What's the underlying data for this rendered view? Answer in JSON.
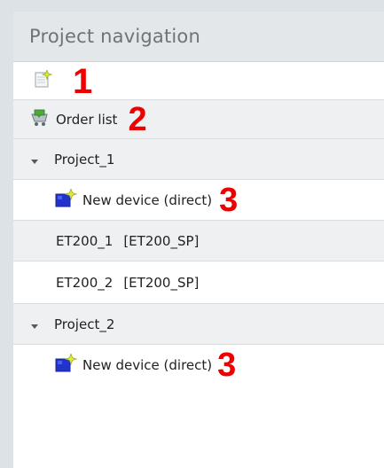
{
  "panel": {
    "title": "Project navigation"
  },
  "toolbar": {
    "new_icon": "new-device-icon",
    "marker": "1"
  },
  "order_list": {
    "label": "Order list",
    "icon": "cart-icon",
    "marker": "2"
  },
  "projects": [
    {
      "name": "Project_1",
      "expanded": true,
      "new_device_label": "New device (direct)",
      "marker": "3",
      "devices": [
        {
          "name": "ET200_1",
          "type": "[ET200_SP]"
        },
        {
          "name": "ET200_2",
          "type": "[ET200_SP]"
        }
      ]
    },
    {
      "name": "Project_2",
      "expanded": true,
      "new_device_label": "New device (direct)",
      "marker": "3",
      "devices": []
    }
  ],
  "colors": {
    "marker": "#ee0000",
    "header_bg": "#e3e7ea",
    "row_shade": "#eef0f2",
    "device_blue": "#2233cc"
  }
}
